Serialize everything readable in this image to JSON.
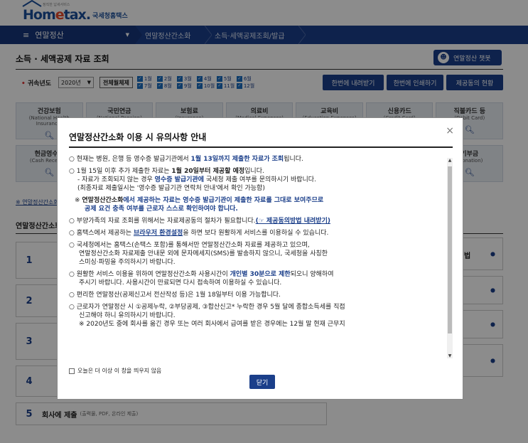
{
  "header": {
    "logo_text": "Hom",
    "logo_text_e": "e",
    "logo_text_rest": "tax.",
    "logo_sub": "국세청홈택스",
    "logo_tag": "정직한 납세서비스"
  },
  "nav": {
    "menu_label": "연말정산",
    "crumbs": [
      "연말정산간소화",
      "소득·세액공제조회/발급"
    ]
  },
  "page": {
    "title": "소득 · 세액공제 자료 조회",
    "chatbot": "연말정산 챗봇"
  },
  "filter": {
    "year_label": "귀속년도",
    "year_value": "2020년",
    "all_button": "전체월체제",
    "months": [
      "1월",
      "2월",
      "3월",
      "4월",
      "5월",
      "6월",
      "7월",
      "8월",
      "9월",
      "10월",
      "11월",
      "12월"
    ],
    "btn_download": "한번에 내려받기",
    "btn_print": "한번에 인쇄하기",
    "btn_consent": "제공동의 현황"
  },
  "categories_row1": [
    {
      "name": "건강보험",
      "en": "(National Health Insurance)"
    },
    {
      "name": "국민연금",
      "en": "(National Pension)"
    },
    {
      "name": "보험료",
      "en": "(Insurance)"
    },
    {
      "name": "의료비",
      "en": "(Medical Expenses)"
    },
    {
      "name": "교육비",
      "en": "(Education Expenses)"
    },
    {
      "name": "신용카드",
      "en": "(Credit Card)"
    },
    {
      "name": "직불카드 등",
      "en": "(Debit Card)"
    }
  ],
  "categories_row2": [
    {
      "name": "현금영수증",
      "en": "(Cash Receipts)"
    },
    {
      "name": "",
      "en": ""
    },
    {
      "name": "",
      "en": ""
    },
    {
      "name": "",
      "en": ""
    },
    {
      "name": "",
      "en": ""
    },
    {
      "name": "",
      "en": ""
    },
    {
      "name": "기부금",
      "en": "(Donation)"
    }
  ],
  "note": "※ 연말정산간소화",
  "section_title": "연말정산간소화",
  "steps": [
    {
      "num": "1",
      "label": "",
      "sub": ""
    },
    {
      "num": "2",
      "label": "",
      "sub": ""
    },
    {
      "num": "3",
      "label": "",
      "sub": ""
    },
    {
      "num": "4",
      "label": "",
      "sub": ""
    },
    {
      "num": "5",
      "label": "회사에 제출",
      "sub": "(출력물, PDF, 온라인 제출)"
    }
  ],
  "right_box_label": "법",
  "modal": {
    "title": "연말정산간소화 이용 시 유의사항 안내",
    "close_icon": "×",
    "items": [
      {
        "a": "○ 현재는 병원, 은행 등 영수증 발급기관에서 ",
        "b": "1월 13일까지 제출한 자료가 조회",
        "c": "됩니다."
      },
      {
        "a": "○ 1월 15일 이후 추가 제출한 자료는 ",
        "b": "1월 20일부터 제공할 예정",
        "c": "입니다."
      },
      {
        "a": "- 자료가 조회되지 않는 경우 ",
        "b": "영수증 발급기관에",
        "c": " 국세청 제출 여부를 문의하시기 바랍니다."
      },
      {
        "a": "(최종자료 제출일시는 '영수증 발급기관 연락처 안내'에서 확인 가능함)",
        "b": "",
        "c": ""
      },
      {
        "a": "※ ",
        "b": "연말정산간소화",
        "c": "에서 제공하는 자료는 영수증 발급기관이 제출한 자료를 그대로 보여주므로"
      },
      {
        "a": "공제 요건 충족 여부를 근로자 스스로 확인하여야 합니다.",
        "b": "",
        "c": ""
      },
      {
        "a": "○ 부양가족의 자료 조회를 위해서는 자료제공동의 절차가 필요합니다.",
        "b": "(☞ 제공동의방법 내려받기)",
        "c": ""
      },
      {
        "a": "○ 홈택스에서 제공하는 ",
        "b": "브라우저 환경설정",
        "c": "을 하면 보다 원활하게 서비스를 이용하실 수 있습니다."
      },
      {
        "a": "○ 국세청에서는 홈택스(손택스 포함)를 통해서만 연말정산간소화 자료를 제공하고 있으며,",
        "b": "",
        "c": ""
      },
      {
        "a": "연말정산간소화 자료제출 안내문 외에 문자메세지(SMS)를 발송하지 않으니, 국세청을 사칭한",
        "b": "",
        "c": ""
      },
      {
        "a": "스미싱·파밍을 주의하시기 바랍니다.",
        "b": "",
        "c": ""
      },
      {
        "a": "○ 원활한 서비스 이용을 위하여 연말정산간소화 사용시간이 ",
        "b": "개인별 30분으로 제한",
        "c": "되오니 양해하여"
      },
      {
        "a": "주시기 바랍니다. 사용시간이 만료되면 다시 접속하여 이용하실 수 있습니다.",
        "b": "",
        "c": ""
      },
      {
        "a": "○ 편리한 연말정산(공제신고서 전산작성 등)은 1월 18일부터 이용 가능합니다.",
        "b": "",
        "c": ""
      },
      {
        "a": "○ 근로자가 연말정산 시 ①공제누락, ②부당공제, ③합산신고* 누락한 경우 5월 달에 종합소득세를 직접",
        "b": "",
        "c": ""
      },
      {
        "a": "신고해야 하니 유의하시기 바랍니다.",
        "b": "",
        "c": ""
      },
      {
        "a": "※ 2020년도 중에 회사를 옮긴 경우 또는 여러 회사에서 급여를 받은 경우에는 12월 말 현재 근무지",
        "b": "",
        "c": ""
      }
    ],
    "checkbox_label": "오늘은 더 이상 이 창을 띄우지 않음",
    "close_button": "닫기"
  }
}
